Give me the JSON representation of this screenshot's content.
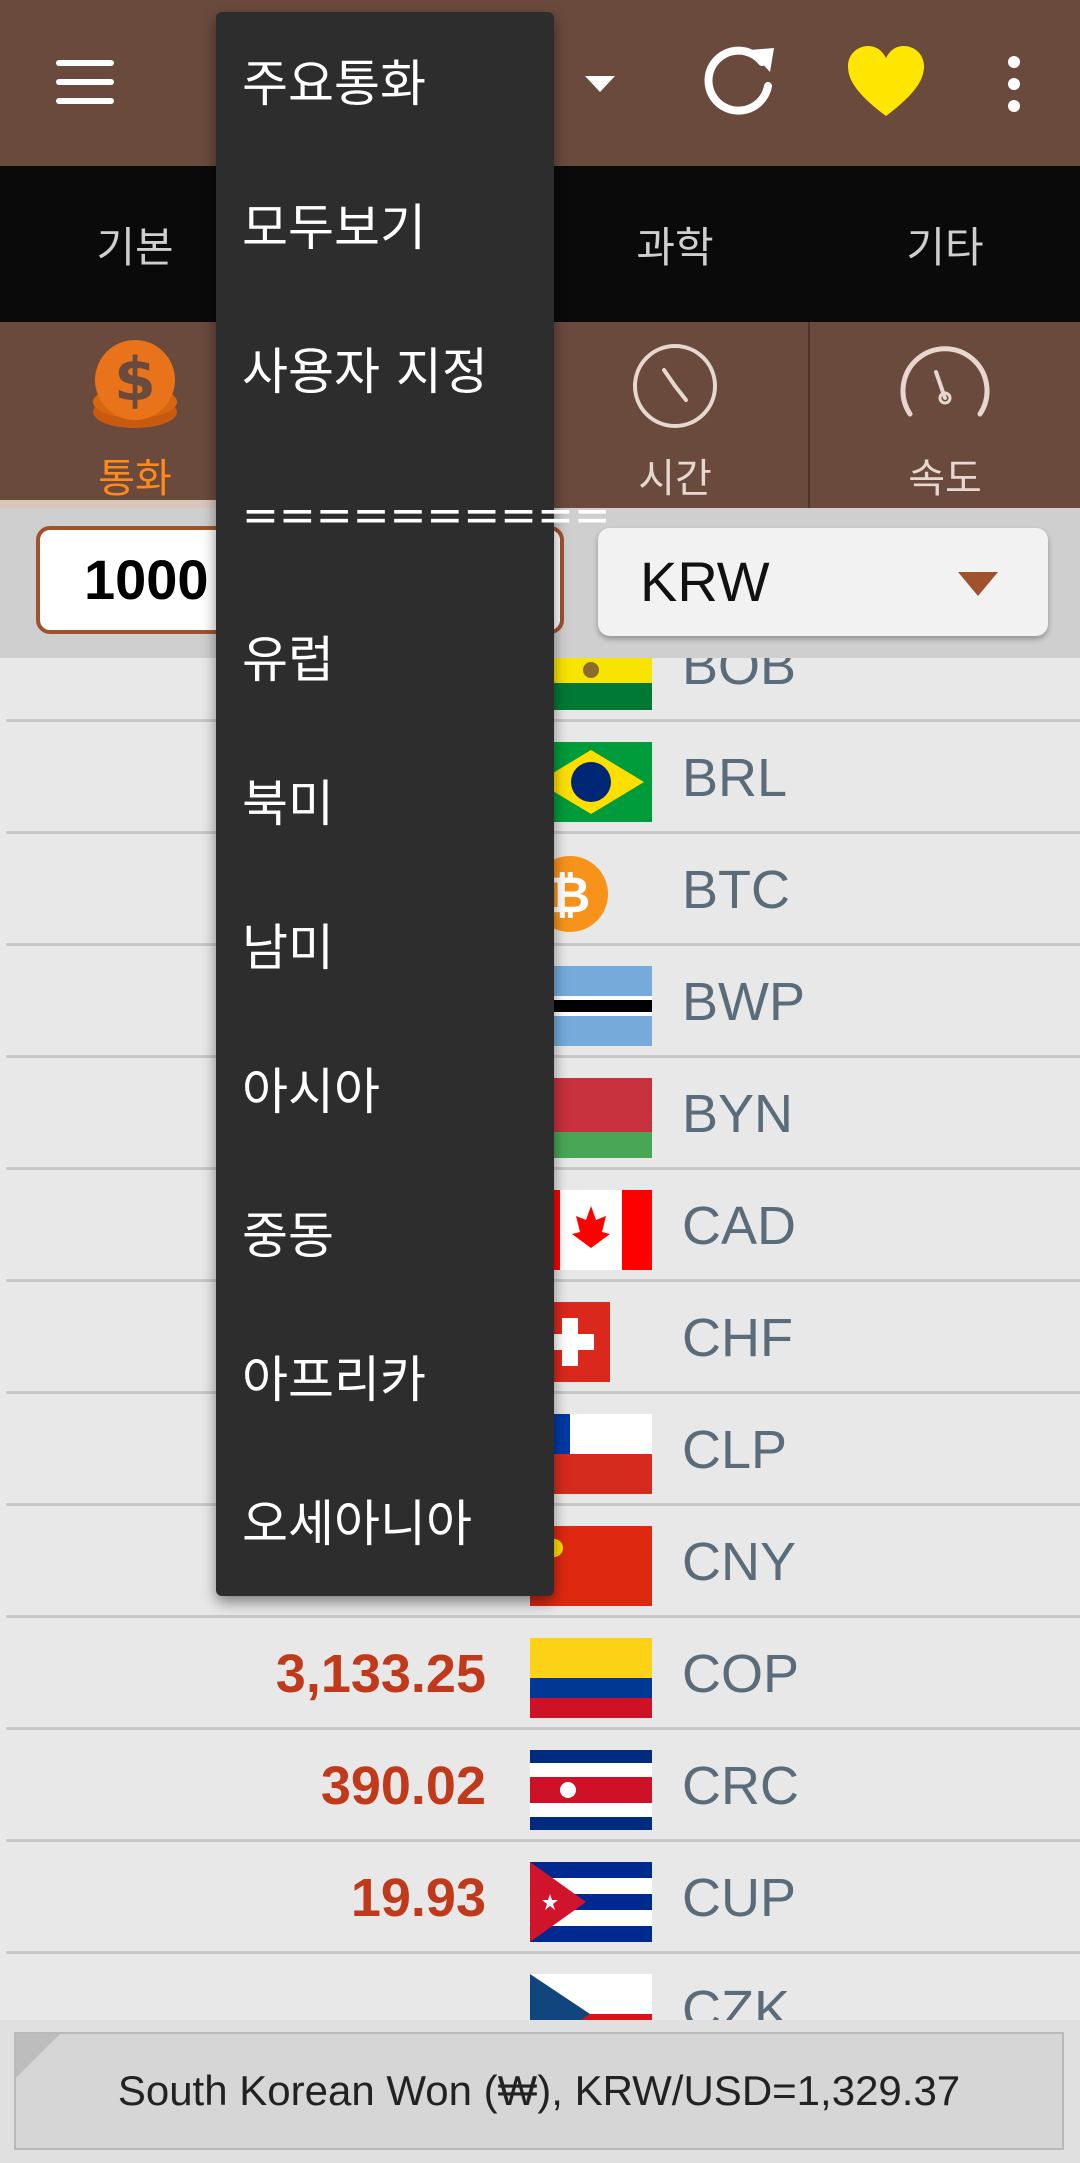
{
  "app_bar": {
    "icons": [
      "hamburger-icon",
      "refresh-icon",
      "heart-icon",
      "more-vert-icon"
    ]
  },
  "categories": [
    "기본",
    "과학",
    "기타"
  ],
  "units": [
    {
      "label": "통화",
      "icon": "dollar-coin-icon",
      "active": true
    },
    {
      "label": "시간",
      "icon": "clock-icon",
      "active": false
    },
    {
      "label": "속도",
      "icon": "speedometer-icon",
      "active": false
    }
  ],
  "input": {
    "amount": "1000",
    "currency": "KRW"
  },
  "rows": [
    {
      "value": "",
      "code": "BOB"
    },
    {
      "value": "",
      "code": "BRL"
    },
    {
      "value": "",
      "code": "BTC"
    },
    {
      "value": "",
      "code": "BWP"
    },
    {
      "value": "",
      "code": "BYN"
    },
    {
      "value": "",
      "code": "CAD"
    },
    {
      "value": "",
      "code": "CHF"
    },
    {
      "value": "",
      "code": "CLP"
    },
    {
      "value": "",
      "code": "CNY"
    },
    {
      "value": "3,133.25",
      "code": "COP"
    },
    {
      "value": "390.02",
      "code": "CRC"
    },
    {
      "value": "19.93",
      "code": "CUP"
    },
    {
      "value": "",
      "code": "CZK"
    }
  ],
  "status": {
    "text": "South Korean Won (₩), KRW/USD=1,329.37"
  },
  "dropdown": {
    "items": [
      "주요통화",
      "모두보기",
      "사용자 지정",
      "==========",
      "유럽",
      "북미",
      "남미",
      "아시아",
      "중동",
      "아프리카",
      "오세아니아"
    ]
  },
  "colors": {
    "appbar": "#6b4a3e",
    "accent": "#ff8a1a",
    "value": "#c0391b",
    "heart": "#ffe600"
  }
}
